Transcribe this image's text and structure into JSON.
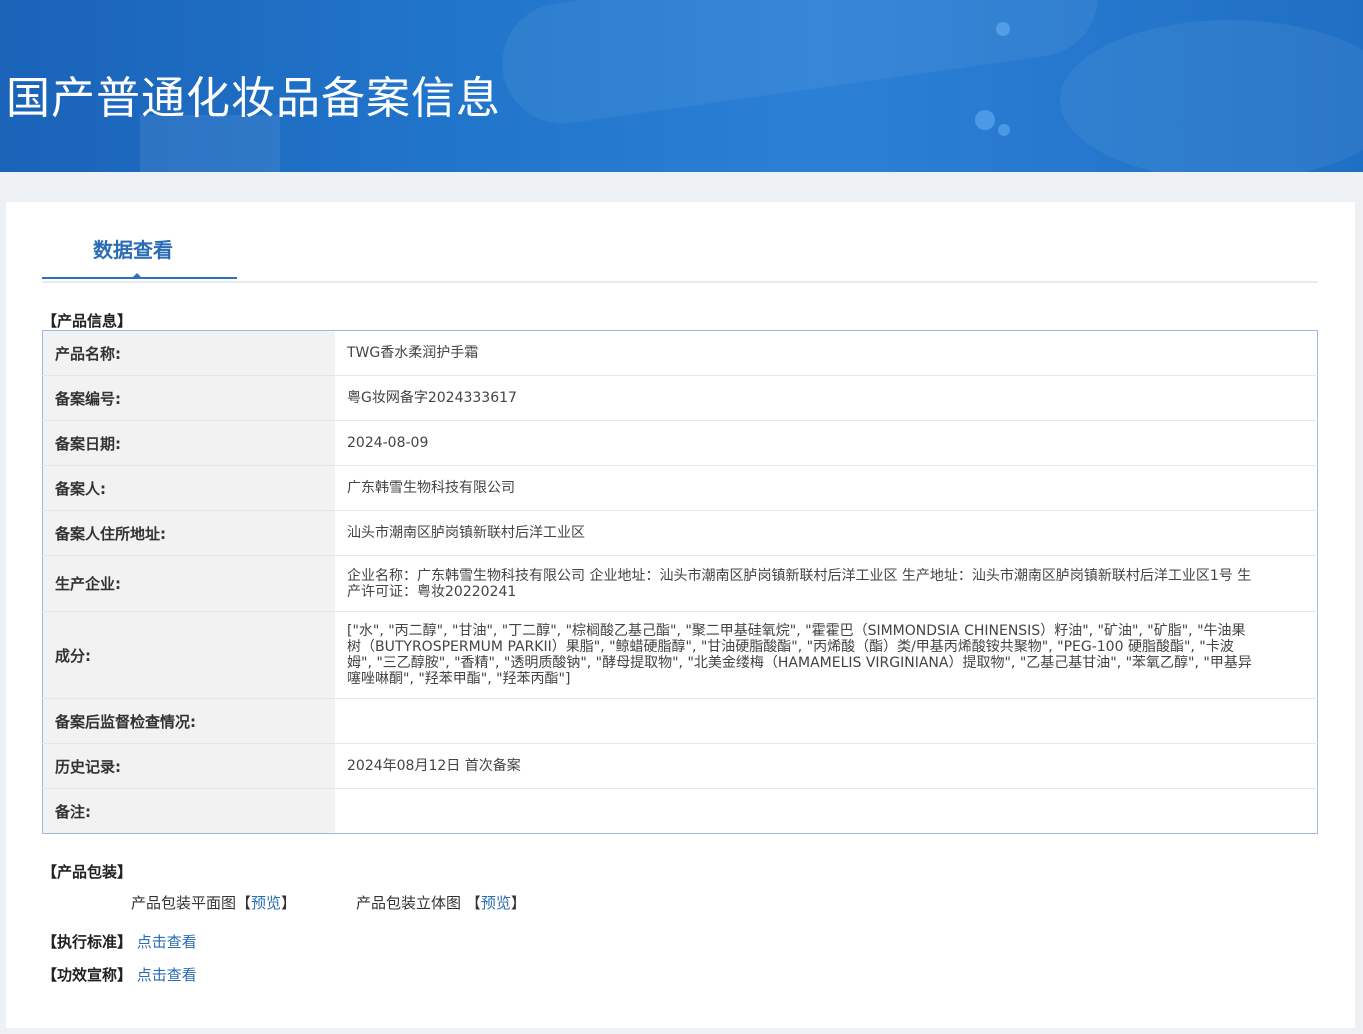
{
  "header": {
    "title": "国产普通化妆品备案信息"
  },
  "tabs": [
    {
      "label": "数据查看"
    }
  ],
  "product_info": {
    "section_title": "【产品信息】",
    "rows": [
      {
        "label": "产品名称:",
        "value": "TWG香水柔润护手霜"
      },
      {
        "label": "备案编号:",
        "value": "粤G妆网备字2024333617"
      },
      {
        "label": "备案日期:",
        "value": "2024-08-09"
      },
      {
        "label": "备案人:",
        "value": "广东韩雪生物科技有限公司"
      },
      {
        "label": "备案人住所地址:",
        "value": "汕头市潮南区胪岗镇新联村后洋工业区"
      },
      {
        "label": "生产企业:",
        "value": "企业名称：广东韩雪生物科技有限公司 企业地址：汕头市潮南区胪岗镇新联村后洋工业区 生产地址：汕头市潮南区胪岗镇新联村后洋工业区1号 生产许可证：粤妆20220241"
      },
      {
        "label": "成分:",
        "value": "[\"水\", \"丙二醇\", \"甘油\", \"丁二醇\", \"棕榈酸乙基己酯\", \"聚二甲基硅氧烷\", \"霍霍巴（SIMMONDSIA CHINENSIS）籽油\", \"矿油\", \"矿脂\", \"牛油果树（BUTYROSPERMUM PARKII）果脂\", \"鲸蜡硬脂醇\", \"甘油硬脂酸酯\", \"丙烯酸（酯）类/甲基丙烯酸铵共聚物\", \"PEG-100 硬脂酸酯\", \"卡波姆\", \"三乙醇胺\", \"香精\", \"透明质酸钠\", \"酵母提取物\", \"北美金缕梅（HAMAMELIS VIRGINIANA）提取物\", \"乙基己基甘油\", \"苯氧乙醇\", \"甲基异噻唑啉酮\", \"羟苯甲酯\", \"羟苯丙酯\"]"
      },
      {
        "label": "备案后监督检查情况:",
        "value": ""
      },
      {
        "label": "历史记录:",
        "value": "2024年08月12日 首次备案"
      },
      {
        "label": "备注:",
        "value": ""
      }
    ]
  },
  "packaging": {
    "section_title": "【产品包装】",
    "flat_label": "产品包装平面图",
    "flat_link": "预览",
    "stereo_label": "产品包装立体图",
    "stereo_link": "预览",
    "bracket_open": "【",
    "bracket_close": "】"
  },
  "standard": {
    "label": "【执行标准】",
    "link": "点击查看"
  },
  "efficacy": {
    "label": "【功效宣称】",
    "link": "点击查看"
  }
}
